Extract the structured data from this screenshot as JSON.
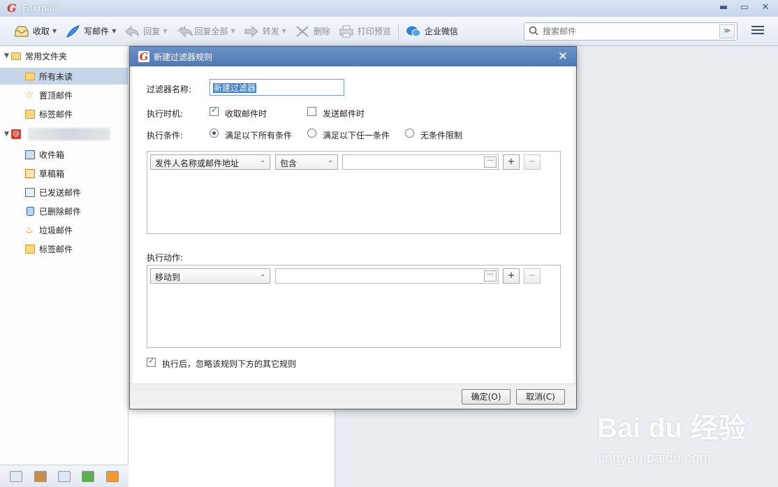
{
  "app": {
    "title": "Foxmail",
    "logo": "G"
  },
  "window_controls": {
    "minimize": "▬",
    "maximize": "▭",
    "close": "✕"
  },
  "toolbar": {
    "receive": "收取",
    "compose": "写邮件",
    "reply": "回复",
    "reply_all": "回复全部",
    "forward": "转发",
    "delete": "删除",
    "print_preview": "打印预览",
    "wechat_work": "企业微信",
    "search_placeholder": "搜索邮件",
    "caret": "▼",
    "search_dropdown": "≫"
  },
  "sidebar": {
    "common_folders": "常用文件夹",
    "items": [
      {
        "label": "所有未读",
        "icon": "folder-icon"
      },
      {
        "label": "置顶邮件",
        "icon": "star-icon"
      },
      {
        "label": "标签邮件",
        "icon": "tag-icon"
      }
    ],
    "account_logo": "@",
    "account_items": [
      {
        "label": "收件箱",
        "icon": "inbox-icon"
      },
      {
        "label": "草稿箱",
        "icon": "drafts-icon"
      },
      {
        "label": "已发送邮件",
        "icon": "sent-icon"
      },
      {
        "label": "已删除邮件",
        "icon": "trash-icon"
      },
      {
        "label": "垃圾邮件",
        "icon": "junk-icon"
      },
      {
        "label": "标签邮件",
        "icon": "tag-icon"
      }
    ]
  },
  "dialog": {
    "logo": "G",
    "title": "新建过滤器规则",
    "close": "✕",
    "name_label": "过滤器名称:",
    "name_value": "新建过滤器",
    "timing_label": "执行时机:",
    "timing_receive": "收取邮件时",
    "timing_send": "发送邮件时",
    "condition_label": "执行条件:",
    "cond_all": "满足以下所有条件",
    "cond_any": "满足以下任一条件",
    "cond_none": "无条件限制",
    "cond_field": "发件人名称或邮件地址",
    "cond_op": "包含",
    "action_label": "执行动作:",
    "action_value": "移动到",
    "ignore_rules": "执行后，忽略该规则下方的其它规则",
    "ok": "确定(O)",
    "cancel": "取消(C)",
    "dots": "···",
    "plus": "+",
    "minus": "−",
    "caret": "⌄"
  },
  "watermark": {
    "main": "Bai du 经验",
    "sub": "jingyan.baidu.com"
  }
}
